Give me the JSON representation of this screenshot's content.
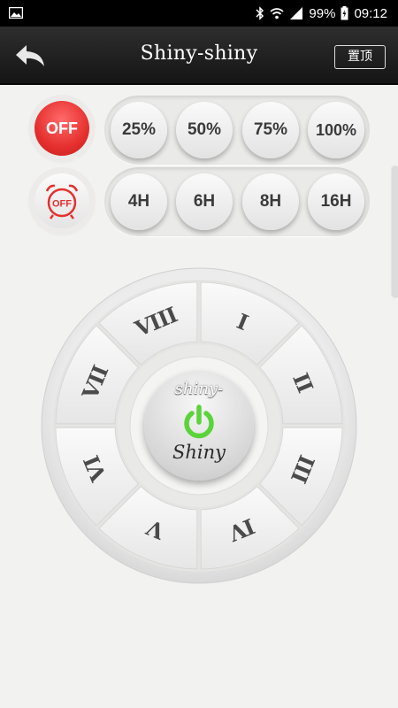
{
  "status_bar": {
    "battery": "99%",
    "time": "09:12",
    "icons": [
      "image-icon",
      "bluetooth-icon",
      "wifi-icon",
      "signal-icon",
      "battery-icon"
    ]
  },
  "header": {
    "title": "Shiny-shiny",
    "pin_label": "置顶",
    "back_icon": "back-arrow-icon"
  },
  "power_row": {
    "off_label": "OFF",
    "levels": [
      "25%",
      "50%",
      "75%",
      "100%"
    ]
  },
  "timer_row": {
    "off_timer_label": "OFF",
    "durations": [
      "4H",
      "6H",
      "8H",
      "16H"
    ]
  },
  "dial": {
    "numerals": [
      "I",
      "II",
      "III",
      "IV",
      "V",
      "VI",
      "VII",
      "VIII"
    ],
    "brand_top": "shiny-",
    "brand_bottom": "Shiny",
    "power_icon": "power-icon"
  },
  "colors": {
    "off_red": "#e5302e",
    "power_green": "#5bd33a",
    "header_dark": "#1e1e1e",
    "background": "#f2f2f0"
  }
}
